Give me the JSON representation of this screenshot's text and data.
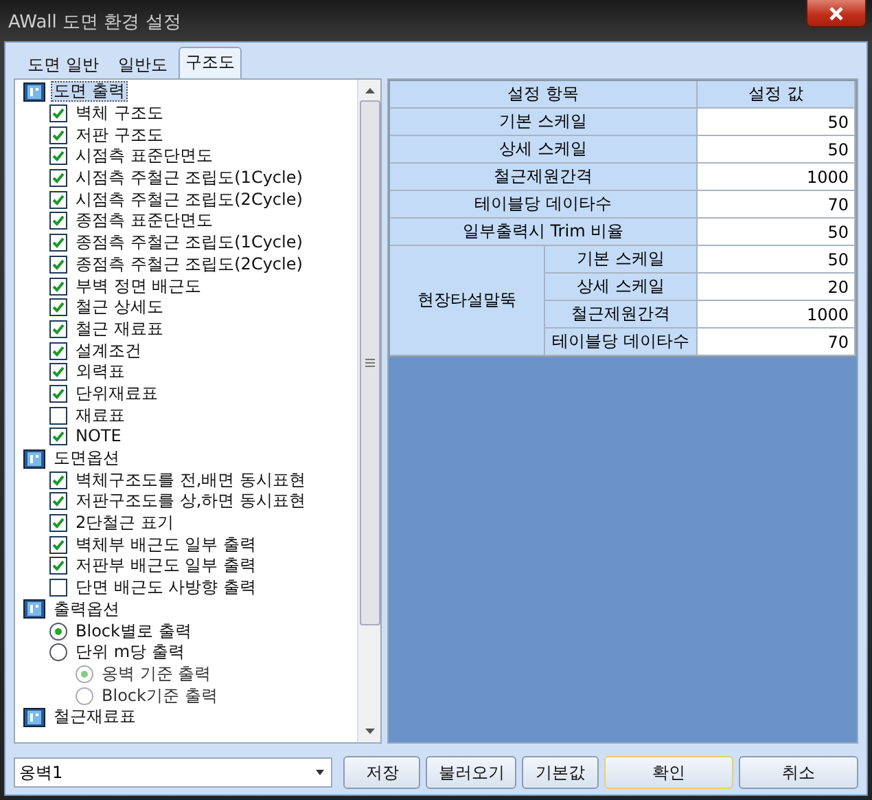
{
  "window": {
    "title": "AWall 도면 환경 설정"
  },
  "tabs": [
    {
      "label": "도면 일반",
      "selected": false
    },
    {
      "label": "일반도",
      "selected": false
    },
    {
      "label": "구조도",
      "selected": true
    }
  ],
  "tree": [
    {
      "label": "도면 출력",
      "kind": "group",
      "selected": true,
      "children": [
        {
          "label": "벽체 구조도",
          "kind": "checkbox",
          "checked": true
        },
        {
          "label": "저판 구조도",
          "kind": "checkbox",
          "checked": true
        },
        {
          "label": "시점측 표준단면도",
          "kind": "checkbox",
          "checked": true
        },
        {
          "label": "시점측 주철근 조립도(1Cycle)",
          "kind": "checkbox",
          "checked": true
        },
        {
          "label": "시점측 주철근 조립도(2Cycle)",
          "kind": "checkbox",
          "checked": true
        },
        {
          "label": "종점측 표준단면도",
          "kind": "checkbox",
          "checked": true
        },
        {
          "label": "종점측 주철근 조립도(1Cycle)",
          "kind": "checkbox",
          "checked": true
        },
        {
          "label": "종점측 주철근 조립도(2Cycle)",
          "kind": "checkbox",
          "checked": true
        },
        {
          "label": "부벽 정면 배근도",
          "kind": "checkbox",
          "checked": true
        },
        {
          "label": "철근 상세도",
          "kind": "checkbox",
          "checked": true
        },
        {
          "label": "철근 재료표",
          "kind": "checkbox",
          "checked": true
        },
        {
          "label": "설계조건",
          "kind": "checkbox",
          "checked": true
        },
        {
          "label": "외력표",
          "kind": "checkbox",
          "checked": true
        },
        {
          "label": "단위재료표",
          "kind": "checkbox",
          "checked": true
        },
        {
          "label": "재료표",
          "kind": "checkbox",
          "checked": false
        },
        {
          "label": "NOTE",
          "kind": "checkbox",
          "checked": true
        }
      ]
    },
    {
      "label": "도면옵션",
      "kind": "group",
      "selected": false,
      "children": [
        {
          "label": "벽체구조도를 전,배면 동시표현",
          "kind": "checkbox",
          "checked": true
        },
        {
          "label": "저판구조도를 상,하면 동시표현",
          "kind": "checkbox",
          "checked": true
        },
        {
          "label": "2단철근 표기",
          "kind": "checkbox",
          "checked": true
        },
        {
          "label": "벽체부 배근도 일부 출력",
          "kind": "checkbox",
          "checked": true
        },
        {
          "label": "저판부 배근도 일부 출력",
          "kind": "checkbox",
          "checked": true
        },
        {
          "label": "단면 배근도 사방향 출력",
          "kind": "checkbox",
          "checked": false
        }
      ]
    },
    {
      "label": "출력옵션",
      "kind": "group",
      "selected": false,
      "children": [
        {
          "label": "Block별로 출력",
          "kind": "radio",
          "selected": true,
          "disabled": false
        },
        {
          "label": "단위 m당 출력",
          "kind": "radio",
          "selected": false,
          "disabled": false,
          "children": [
            {
              "label": "옹벽 기준 출력",
              "kind": "radio",
              "selected": true,
              "disabled": true
            },
            {
              "label": "Block기준 출력",
              "kind": "radio",
              "selected": false,
              "disabled": true
            }
          ]
        }
      ]
    },
    {
      "label": "철근재료표",
      "kind": "group",
      "selected": false
    }
  ],
  "table": {
    "columns": [
      "설정 항목",
      "설정 값"
    ],
    "rows": [
      {
        "kind": "single",
        "label": "기본 스케일",
        "value": "50"
      },
      {
        "kind": "single",
        "label": "상세 스케일",
        "value": "50"
      },
      {
        "kind": "single",
        "label": "철근제원간격",
        "value": "1000"
      },
      {
        "kind": "single",
        "label": "테이블당 데이타수",
        "value": "70"
      },
      {
        "kind": "single",
        "label": "일부출력시 Trim 비율",
        "value": "50"
      },
      {
        "kind": "group",
        "label": "현장타설말뚝",
        "rows": [
          {
            "label": "기본 스케일",
            "value": "50"
          },
          {
            "label": "상세 스케일",
            "value": "20"
          },
          {
            "label": "철근제원간격",
            "value": "1000"
          },
          {
            "label": "테이블당 데이타수",
            "value": "70"
          }
        ]
      }
    ]
  },
  "footer": {
    "combo_value": "옹벽1",
    "buttons": [
      {
        "label": "저장",
        "default": false
      },
      {
        "label": "불러오기",
        "default": false
      },
      {
        "label": "기본값",
        "default": false
      },
      {
        "label": "확인",
        "default": true
      },
      {
        "label": "취소",
        "default": false
      }
    ]
  }
}
